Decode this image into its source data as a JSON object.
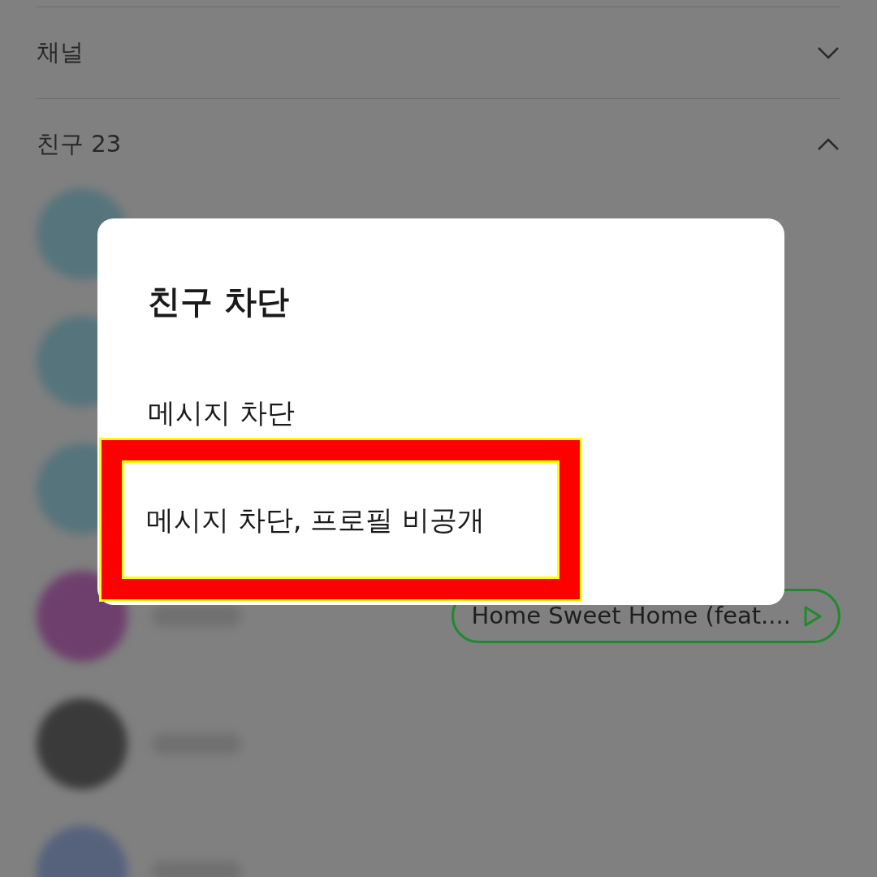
{
  "sections": [
    {
      "title": "채널",
      "expanded": false
    },
    {
      "title": "친구 23",
      "expanded": true
    }
  ],
  "friends": [
    {
      "color": "#56747c"
    },
    {
      "color": "#56747c"
    },
    {
      "color": "#56747c"
    },
    {
      "color": "#6e3f6c",
      "name_blurred": true,
      "music": "Home Sweet Home (feat...."
    },
    {
      "color": "#3a3a3a",
      "name_blurred": true
    },
    {
      "color": "#56627c",
      "name_blurred": true
    }
  ],
  "dialog": {
    "title": "친구 차단",
    "options": [
      {
        "label": "메시지 차단",
        "highlighted": false
      },
      {
        "label": "메시지 차단, 프로필 비공개",
        "highlighted": true
      }
    ]
  }
}
